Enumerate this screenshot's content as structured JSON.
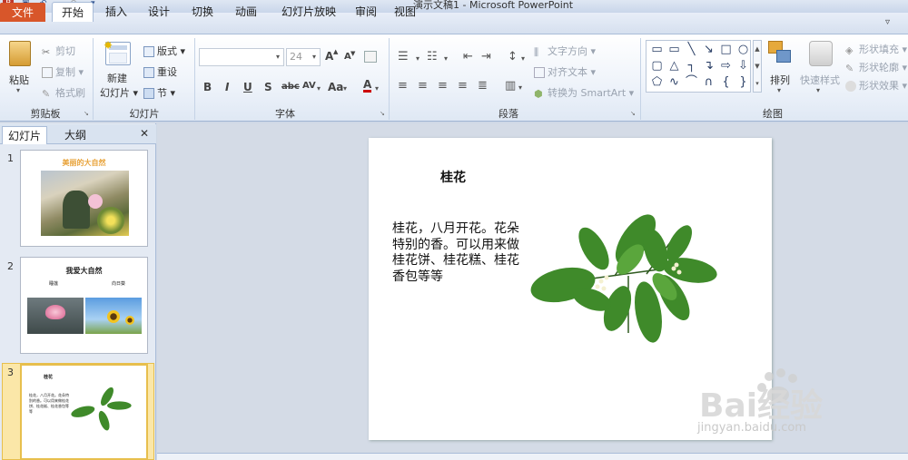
{
  "window": {
    "title": "演示文稿1 - Microsoft PowerPoint"
  },
  "tabs": [
    {
      "label": "文件"
    },
    {
      "label": "开始"
    },
    {
      "label": "插入"
    },
    {
      "label": "设计"
    },
    {
      "label": "切换"
    },
    {
      "label": "动画"
    },
    {
      "label": "幻灯片放映"
    },
    {
      "label": "审阅"
    },
    {
      "label": "视图"
    }
  ],
  "ribbon": {
    "clipboard": {
      "paste": "粘贴",
      "cut": "剪切",
      "copy": "复制",
      "format_painter": "格式刷",
      "group": "剪贴板"
    },
    "slides": {
      "new_slide_1": "新建",
      "new_slide_2": "幻灯片",
      "layout": "版式",
      "reset": "重设",
      "section": "节",
      "group": "幻灯片"
    },
    "font": {
      "font_name": "",
      "font_size": "24",
      "bold": "B",
      "italic": "I",
      "underline": "U",
      "shadow": "S",
      "strike": "abc",
      "spacing": "AV",
      "case": "Aa",
      "color": "A",
      "grow": "A",
      "shrink": "A",
      "group": "字体"
    },
    "paragraph": {
      "text_direction": "文字方向",
      "align_text": "对齐文本",
      "smartart": "转换为 SmartArt",
      "group": "段落"
    },
    "drawing": {
      "arrange": "排列",
      "quick_styles": "快速样式",
      "shape_fill": "形状填充",
      "shape_outline": "形状轮廓",
      "shape_effects": "形状效果",
      "group": "绘图"
    }
  },
  "panel": {
    "tab_slides": "幻灯片",
    "tab_outline": "大纲",
    "close": "✕"
  },
  "thumbnails": [
    {
      "number": "1",
      "title": "美丽的大自然"
    },
    {
      "number": "2",
      "title": "我爱大自然",
      "label_a": "睡莲",
      "label_b": "向日葵"
    },
    {
      "number": "3",
      "title": "桂花",
      "body": "桂花，八月开花。花朵特别的香。可以用来做桂花饼、桂花糕、桂花香包等等"
    }
  ],
  "slide": {
    "title": "桂花",
    "body": "桂花，八月开花。花朵特别的香。可以用来做桂花饼、桂花糕、桂花香包等等"
  },
  "watermark": {
    "brand": "Bai经验",
    "url": "jingyan.baidu.com"
  },
  "colors": {
    "file_tab": "#d8562a",
    "ribbon_accent": "#2b4f8e",
    "leaf": "#3f8a2a"
  }
}
